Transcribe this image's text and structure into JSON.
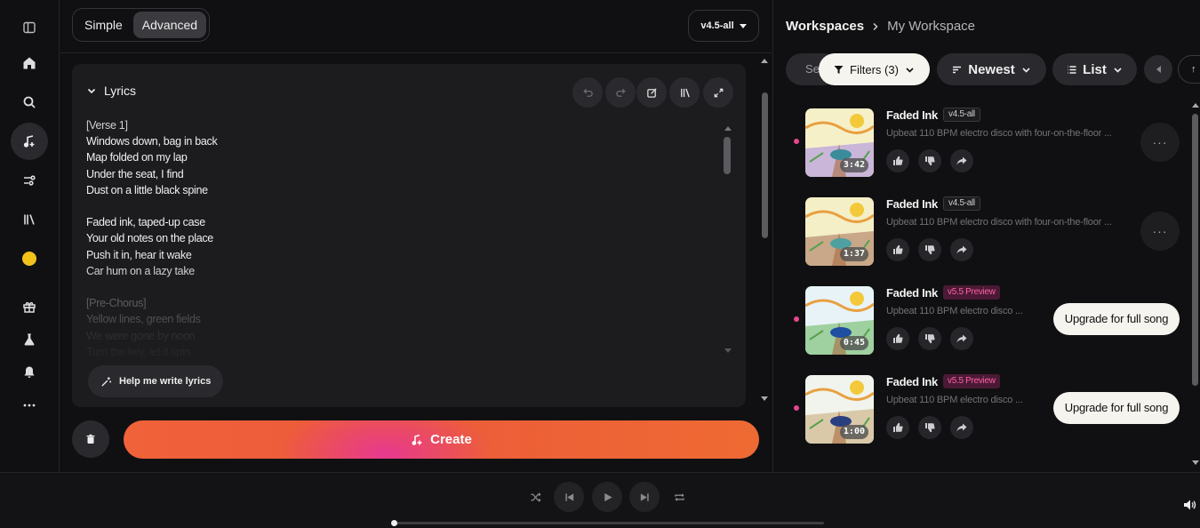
{
  "rail": {
    "items": [
      {
        "name": "sidebar-toggle-icon",
        "active": false
      },
      {
        "name": "home-icon",
        "active": false
      },
      {
        "name": "search-icon",
        "active": false
      },
      {
        "name": "create-music-icon",
        "active": true
      },
      {
        "name": "studio-icon",
        "active": false
      },
      {
        "name": "library-icon",
        "active": false
      },
      {
        "name": "credits-dot",
        "active": false
      },
      {
        "name": "gift-icon",
        "active": false
      },
      {
        "name": "labs-icon",
        "active": false
      },
      {
        "name": "notifications-icon",
        "active": false
      },
      {
        "name": "more-icon",
        "active": false
      }
    ]
  },
  "create": {
    "mode_simple": "Simple",
    "mode_advanced": "Advanced",
    "mode_selected": "Advanced",
    "version": "v4.5-all",
    "lyrics_label": "Lyrics",
    "help_label": "Help me write lyrics",
    "create_label": "Create",
    "lyrics_lines": [
      {
        "text": "[Verse 1]",
        "style": "tag"
      },
      {
        "text": "Windows down, bag in back",
        "style": ""
      },
      {
        "text": "Map folded on my lap",
        "style": ""
      },
      {
        "text": "Under the seat, I find",
        "style": ""
      },
      {
        "text": "Dust on a little black spine",
        "style": ""
      },
      {
        "text": "",
        "style": "gap"
      },
      {
        "text": "Faded ink, taped-up case",
        "style": ""
      },
      {
        "text": "Your old notes on the place",
        "style": ""
      },
      {
        "text": "Push it in, hear it wake",
        "style": ""
      },
      {
        "text": "Car hum on a lazy take",
        "style": ""
      },
      {
        "text": "",
        "style": "gap"
      },
      {
        "text": "[Pre-Chorus]",
        "style": "faded"
      },
      {
        "text": "Yellow lines, green fields",
        "style": "faded"
      },
      {
        "text": "We were gone by noon",
        "style": "faded2"
      },
      {
        "text": "Turn the key, let it spin",
        "style": "faded2"
      }
    ]
  },
  "workspace": {
    "crumb_root": "Workspaces",
    "crumb_current": "My Workspace",
    "search_placeholder": "Se",
    "filters_label": "Filters (3)",
    "sort_label": "Newest",
    "view_label": "List",
    "songs": [
      {
        "title": "Faded Ink",
        "badge": "v4.5-all",
        "badge_style": "plain",
        "description": "Upbeat 110 BPM electro disco with four-on-the-floor ...",
        "duration": "3:42",
        "new": true,
        "action": "more"
      },
      {
        "title": "Faded Ink",
        "badge": "v4.5-all",
        "badge_style": "plain",
        "description": "Upbeat 110 BPM electro disco with four-on-the-floor ...",
        "duration": "1:37",
        "new": false,
        "action": "more"
      },
      {
        "title": "Faded Ink",
        "badge": "v5.5 Preview",
        "badge_style": "preview",
        "description": "Upbeat 110 BPM electro disco ...",
        "duration": "0:45",
        "new": true,
        "action": "upgrade"
      },
      {
        "title": "Faded Ink",
        "badge": "v5.5 Preview",
        "badge_style": "preview",
        "description": "Upbeat 110 BPM electro disco ...",
        "duration": "1:00",
        "new": true,
        "action": "upgrade"
      }
    ],
    "upgrade_label": "Upgrade for full song"
  },
  "player": {
    "progress": 0.0
  },
  "colors": {
    "accent_orange": "#f0623a",
    "accent_pink": "#e8398f",
    "new_dot": "#e9468f",
    "credits": "#f2c21b"
  }
}
